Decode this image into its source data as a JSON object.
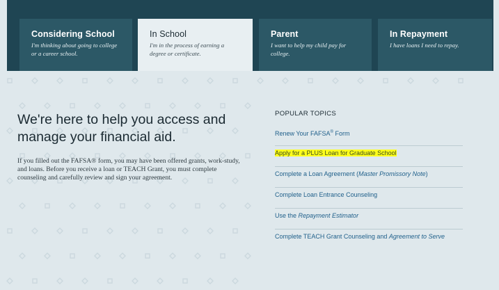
{
  "tabs": [
    {
      "title": "Considering School",
      "desc": "I'm thinking about going to college or a career school.",
      "active": false
    },
    {
      "title": "In School",
      "desc": "I'm in the process of earning a degree or certificate.",
      "active": true
    },
    {
      "title": "Parent",
      "desc": "I want to help my child pay for college.",
      "active": false
    },
    {
      "title": "In Repayment",
      "desc": "I have loans I need to repay.",
      "active": false
    }
  ],
  "hero": {
    "title": "We're here to help you access and manage your financial aid.",
    "body": "If you filled out the FAFSA® form, you may have been offered grants, work-study, and loans. Before you receive a loan or TEACH Grant, you must complete counseling and carefully review and sign your agreement."
  },
  "popular_topics": {
    "heading": "POPULAR TOPICS",
    "links": [
      {
        "pre": "Renew Your FAFSA",
        "sup": "®",
        "post": " Form",
        "highlight": false
      },
      {
        "pre": "Apply for a PLUS Loan for Graduate School",
        "highlight": true
      },
      {
        "pre": "Complete a Loan Agreement (",
        "em": "Master Promissory Note",
        "post": ")",
        "highlight": false
      },
      {
        "pre": "Complete Loan Entrance Counseling",
        "highlight": false
      },
      {
        "pre": "Use the ",
        "em": "Repayment Estimator",
        "highlight": false
      },
      {
        "pre": "Complete TEACH Grant Counseling and ",
        "em": "Agreement to Serve",
        "highlight": false
      }
    ]
  },
  "colors": {
    "band": "#1f4553",
    "tab": "#2c5866",
    "active_tab": "#e8eff2",
    "background": "#dfe8ec",
    "link": "#1f5f8a",
    "highlight": "#ffff1a"
  }
}
